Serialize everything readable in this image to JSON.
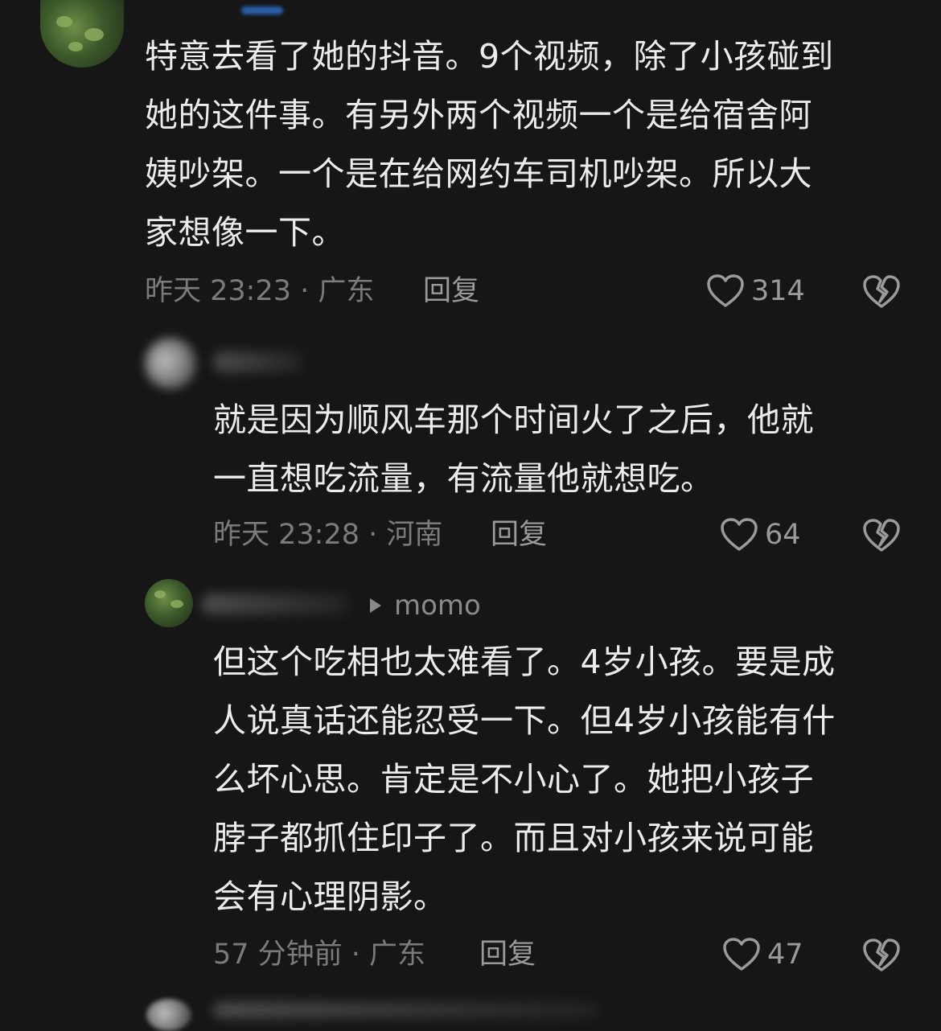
{
  "comments": [
    {
      "text_lines": [
        "特意去看了她的抖音。9个视频，除了小孩碰到",
        "她的这件事。有另外两个视频一个是给宿舍阿",
        "姨吵架。一个是在给网约车司机吵架。所以大",
        "家想像一下。"
      ],
      "meta": "昨天 23:23 · 广东",
      "reply_label": "回复",
      "likes": "314"
    },
    {
      "text_lines": [
        "就是因为顺风车那个时间火了之后，他就",
        "一直想吃流量，有流量他就想吃。"
      ],
      "meta": "昨天 23:28 · 河南",
      "reply_label": "回复",
      "likes": "64"
    },
    {
      "reply_to": "momo",
      "text_lines": [
        "但这个吃相也太难看了。4岁小孩。要是成",
        "人说真话还能忍受一下。但4岁小孩能有什",
        "么坏心思。肯定是不小心了。她把小孩子",
        "脖子都抓住印子了。而且对小孩来说可能",
        "会有心理阴影。"
      ],
      "meta": "57 分钟前 · 广东",
      "reply_label": "回复",
      "likes": "47"
    }
  ],
  "icons": {
    "like": "heart-outline-icon",
    "dislike": "broken-heart-icon"
  },
  "colors": {
    "background": "#161616",
    "text": "#ececec",
    "muted": "#7b7b7b"
  }
}
